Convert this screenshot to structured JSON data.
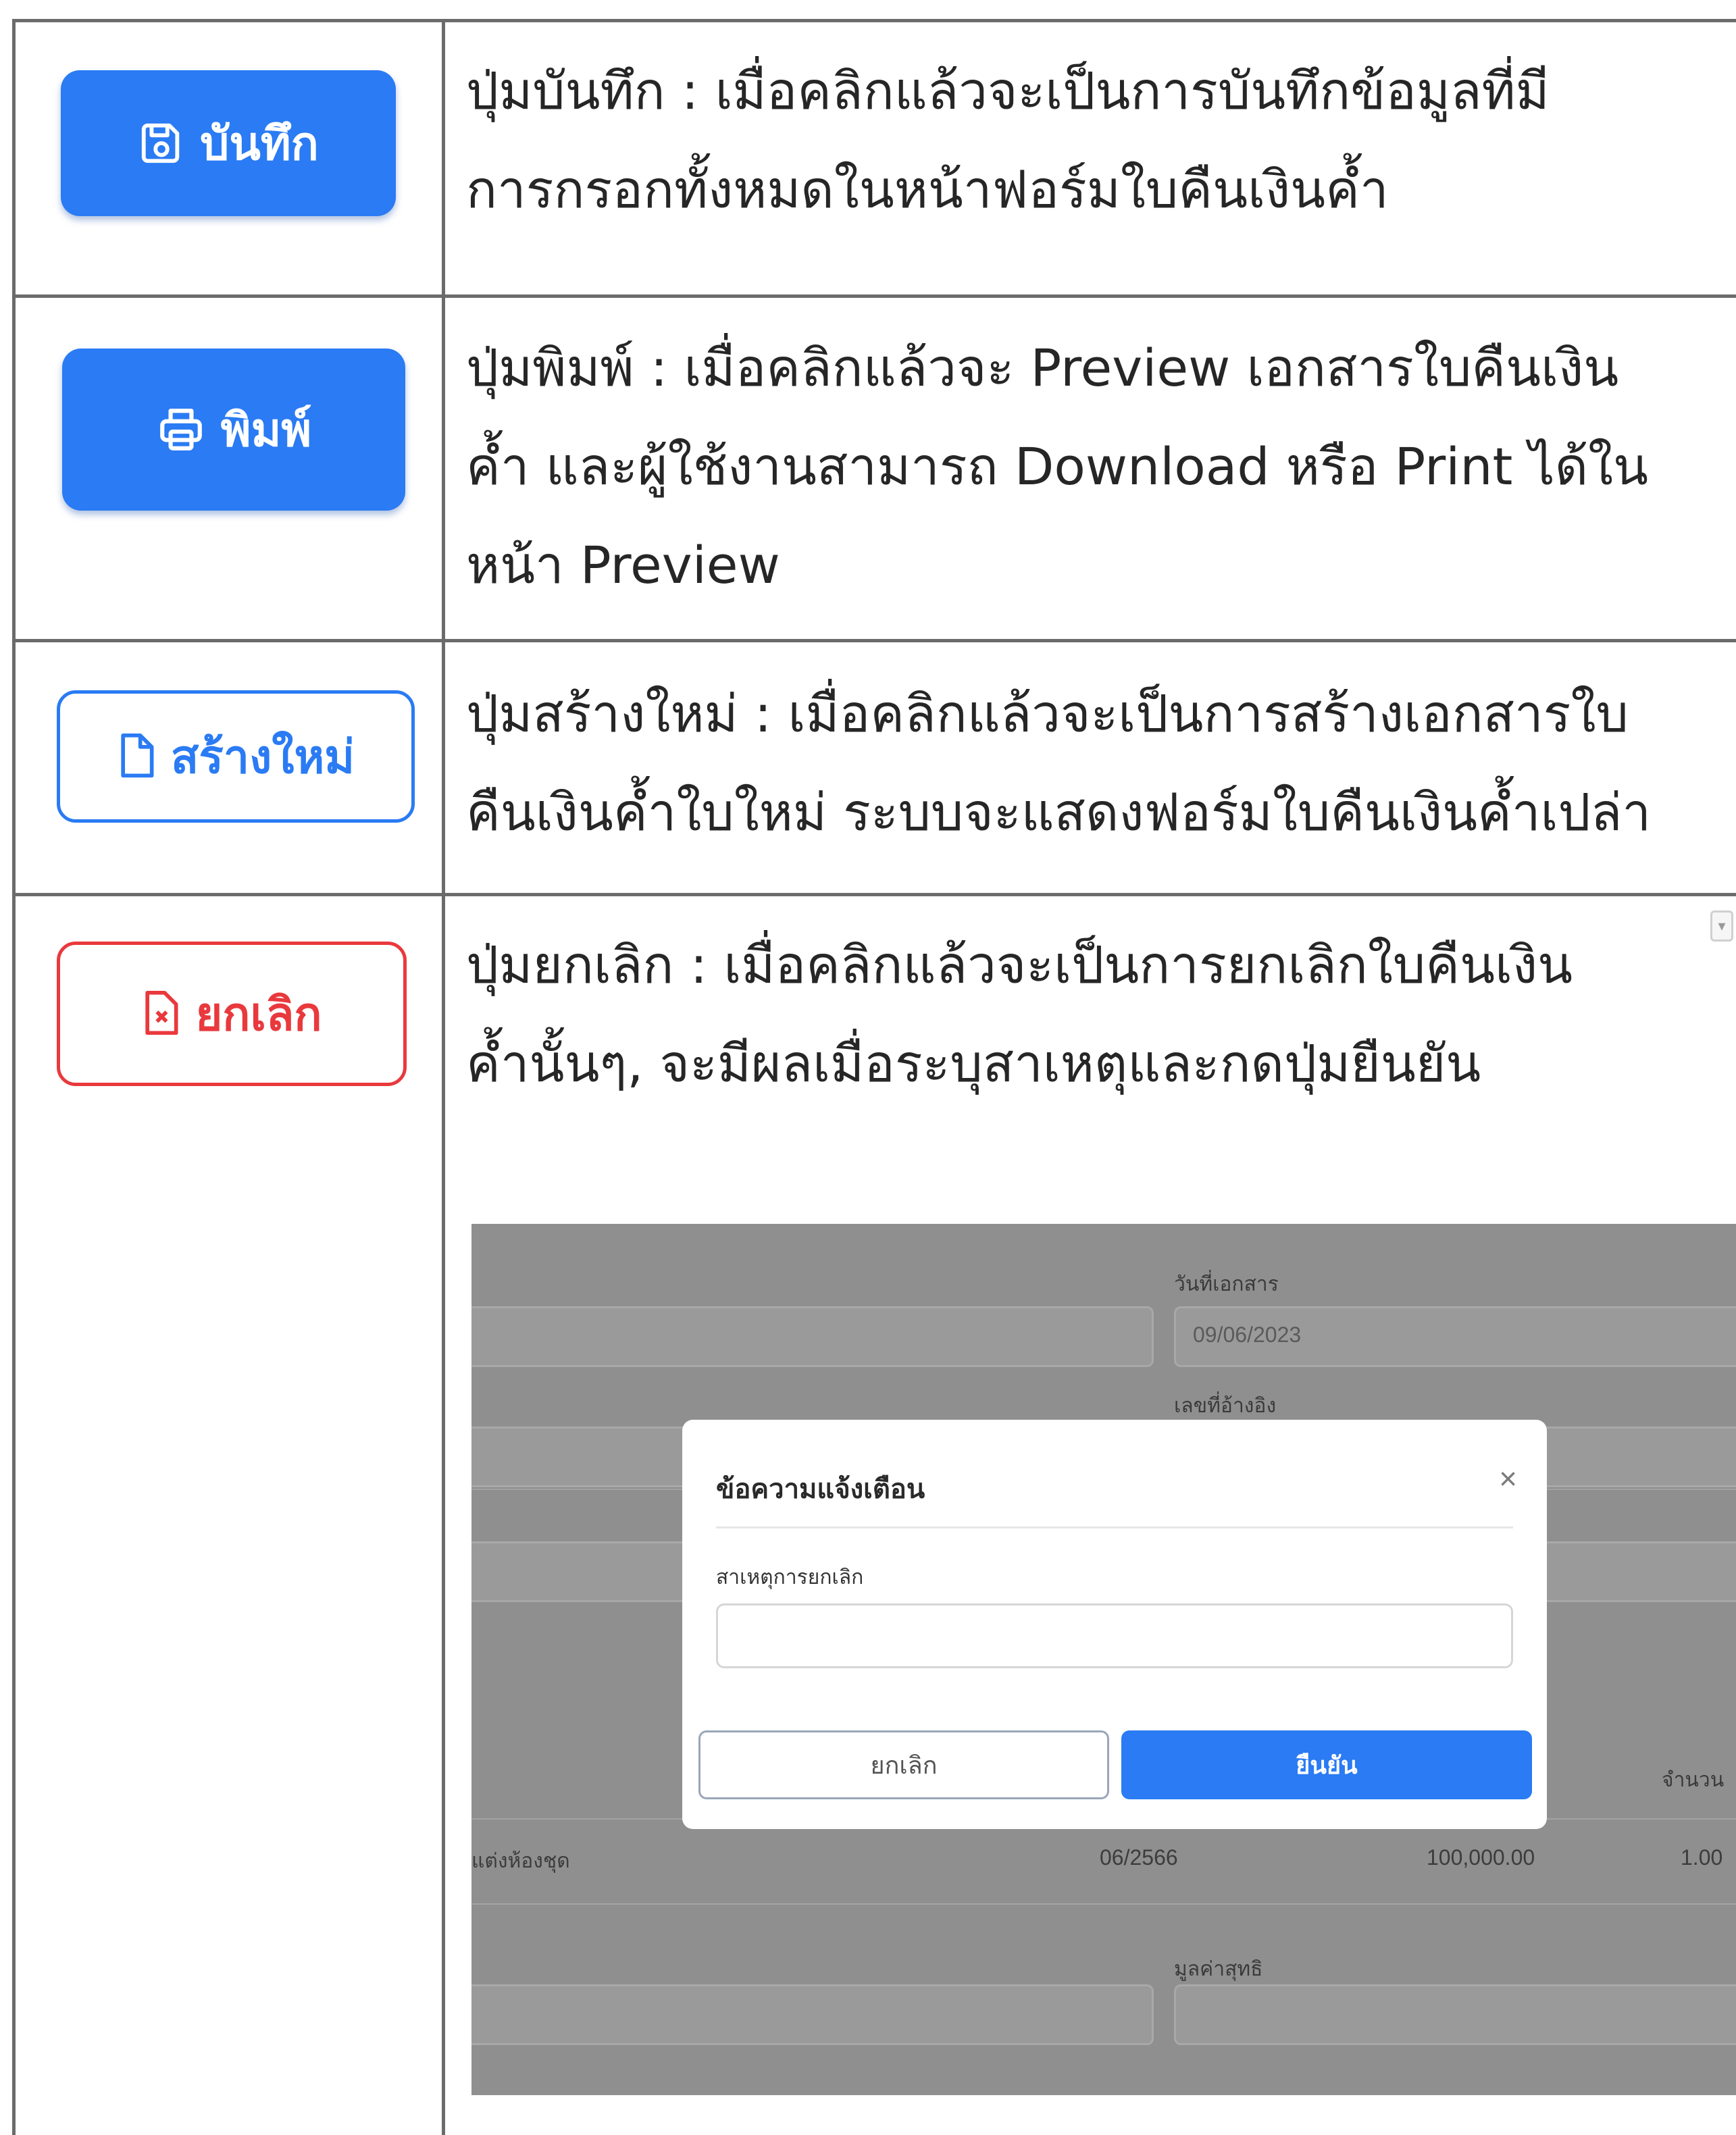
{
  "rows": [
    {
      "button_label": "บันทึก",
      "button_icon": "save-icon",
      "lines": [
        "ปุ่มบันทึก : เมื่อคลิกแล้วจะเป็นการบันทึกข้อมูลที่มี",
        "การกรอกทั้งหมดในหน้าฟอร์มใบคืนเงินค้ำ"
      ]
    },
    {
      "button_label": "พิมพ์",
      "button_icon": "printer-icon",
      "lines": [
        "ปุ่มพิมพ์ : เมื่อคลิกแล้วจะ Preview เอกสารใบคืนเงิน",
        "ค้ำ และผู้ใช้งานสามารถ Download หรือ Print ได้ใน",
        "หน้า Preview"
      ]
    },
    {
      "button_label": "สร้างใหม่",
      "button_icon": "new-file-icon",
      "lines": [
        "ปุ่มสร้างใหม่ : เมื่อคลิกแล้วจะเป็นการสร้างเอกสารใบ",
        "คืนเงินค้ำใบใหม่ ระบบจะแสดงฟอร์มใบคืนเงินค้ำเปล่า"
      ]
    },
    {
      "button_label": "ยกเลิก",
      "button_icon": "cancel-file-icon",
      "lines": [
        "ปุ่มยกเลิก : เมื่อคลิกแล้วจะเป็นการยกเลิกใบคืนเงิน",
        "ค้ำนั้นๆ, จะมีผลเมื่อระบุสาเหตุและกดปุ่มยืนยัน"
      ]
    }
  ],
  "screenshot": {
    "background_form": {
      "doc_date_label": "วันที่เอกสาร",
      "doc_date_value": "09/06/2023",
      "ref_no_label": "เลขที่อ้างอิง",
      "qty_header": "จำนวน",
      "row_item": "แต่งห้องชุด",
      "row_period": "06/2566",
      "row_amount": "100,000.00",
      "row_qty": "1.00",
      "net_value_label": "มูลค่าสุทธิ"
    },
    "modal": {
      "title": "ข้อความแจ้งเตือน",
      "close_symbol": "×",
      "reason_label": "สาเหตุการยกเลิก",
      "reason_value": "",
      "cancel_label": "ยกเลิก",
      "confirm_label": "ยืนยัน"
    }
  },
  "colors": {
    "primary": "#2a7bf4",
    "danger": "#e9393d",
    "table_border": "#6b6b6b",
    "overlay": "#8f8f8f"
  },
  "scroll_handle_glyph": "▾"
}
